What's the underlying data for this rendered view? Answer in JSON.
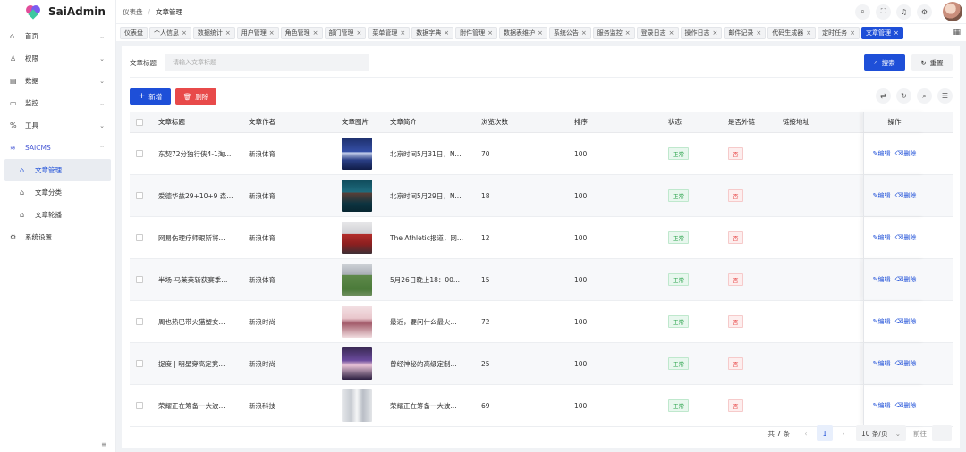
{
  "app": {
    "name": "SaiAdmin"
  },
  "sidebar": {
    "items": [
      {
        "label": "首页",
        "icon": "home-icon",
        "glyph": "⌂",
        "expanded": false
      },
      {
        "label": "权限",
        "icon": "user-icon",
        "glyph": "♙",
        "expanded": false
      },
      {
        "label": "数据",
        "icon": "database-icon",
        "glyph": "▤",
        "expanded": false
      },
      {
        "label": "监控",
        "icon": "monitor-icon",
        "glyph": "▭",
        "expanded": false
      },
      {
        "label": "工具",
        "icon": "tools-icon",
        "glyph": "%",
        "expanded": false
      },
      {
        "label": "SAICMS",
        "icon": "cms-icon",
        "glyph": "≋",
        "expanded": true
      }
    ],
    "sub_items": [
      {
        "label": "文章管理",
        "active": true
      },
      {
        "label": "文章分类",
        "active": false
      },
      {
        "label": "文章轮播",
        "active": false
      }
    ],
    "bottom_item": {
      "label": "系统设置"
    }
  },
  "header": {
    "breadcrumb": [
      "仪表盘",
      "文章管理"
    ]
  },
  "tabs": [
    {
      "label": "仪表盘",
      "closable": false,
      "active": false
    },
    {
      "label": "个人信息",
      "closable": true,
      "active": false
    },
    {
      "label": "数据统计",
      "closable": true,
      "active": false
    },
    {
      "label": "用户管理",
      "closable": true,
      "active": false
    },
    {
      "label": "角色管理",
      "closable": true,
      "active": false
    },
    {
      "label": "部门管理",
      "closable": true,
      "active": false
    },
    {
      "label": "菜单管理",
      "closable": true,
      "active": false
    },
    {
      "label": "数据字典",
      "closable": true,
      "active": false
    },
    {
      "label": "附件管理",
      "closable": true,
      "active": false
    },
    {
      "label": "数据表维护",
      "closable": true,
      "active": false
    },
    {
      "label": "系统公告",
      "closable": true,
      "active": false
    },
    {
      "label": "服务监控",
      "closable": true,
      "active": false
    },
    {
      "label": "登录日志",
      "closable": true,
      "active": false
    },
    {
      "label": "操作日志",
      "closable": true,
      "active": false
    },
    {
      "label": "邮件记录",
      "closable": true,
      "active": false
    },
    {
      "label": "代码生成器",
      "closable": true,
      "active": false
    },
    {
      "label": "定时任务",
      "closable": true,
      "active": false
    },
    {
      "label": "文章管理",
      "closable": true,
      "active": true
    }
  ],
  "search": {
    "label": "文章标题",
    "placeholder": "请输入文章标题",
    "search_button": "搜索",
    "reset_button": "重置"
  },
  "actions": {
    "add_button": "新增",
    "delete_button": "删除"
  },
  "table": {
    "columns": [
      "文章标题",
      "文章作者",
      "文章图片",
      "文章简介",
      "浏览次数",
      "排序",
      "状态",
      "是否外链",
      "链接地址",
      "操作"
    ],
    "rows": [
      {
        "title": "东契72分独行侠4-1淘...",
        "author": "新浪体育",
        "intro": "北京时间5月31日，N...",
        "views": "70",
        "sort": "100",
        "status": "正常",
        "external": "否",
        "url": "",
        "thumb": "basketball-blue"
      },
      {
        "title": "爱德华兹29+10+9 森...",
        "author": "新浪体育",
        "intro": "北京时间5月29日，N...",
        "views": "18",
        "sort": "100",
        "status": "正常",
        "external": "否",
        "url": "",
        "thumb": "basketball-teal"
      },
      {
        "title": "网易伤理疗师跟斯将...",
        "author": "新浪体育",
        "intro": "The Athletic报道，网...",
        "views": "12",
        "sort": "100",
        "status": "正常",
        "external": "否",
        "url": "",
        "thumb": "soccer-red"
      },
      {
        "title": "半场-马莱莱斩获赛季...",
        "author": "新浪体育",
        "intro": "5月26日晚上18：00...",
        "views": "15",
        "sort": "100",
        "status": "正常",
        "external": "否",
        "url": "",
        "thumb": "stadium-green"
      },
      {
        "title": "周也热巴带火猫塑女...",
        "author": "新浪时尚",
        "intro": "最近，要问什么最火...",
        "views": "72",
        "sort": "100",
        "status": "正常",
        "external": "否",
        "url": "",
        "thumb": "fashion-pink"
      },
      {
        "title": "捉度 | 明星穿高定竞...",
        "author": "新浪时尚",
        "intro": "曾经神秘的高级定制...",
        "views": "25",
        "sort": "100",
        "status": "正常",
        "external": "否",
        "url": "",
        "thumb": "fashion-purple"
      },
      {
        "title": "荣耀正在筹备一大波...",
        "author": "新浪科技",
        "intro": "荣耀正在筹备一大波...",
        "views": "69",
        "sort": "100",
        "status": "正常",
        "external": "否",
        "url": "",
        "thumb": "phones-grey"
      }
    ],
    "edit_label": "编辑",
    "delete_label": "删除"
  },
  "pagination": {
    "total_text": "共 7 条",
    "current_page": "1",
    "page_size": "10 条/页",
    "jump_label": "前往"
  },
  "colors": {
    "primary": "#1e4fd8",
    "danger": "#e84a4a",
    "success": "#2da44e"
  }
}
